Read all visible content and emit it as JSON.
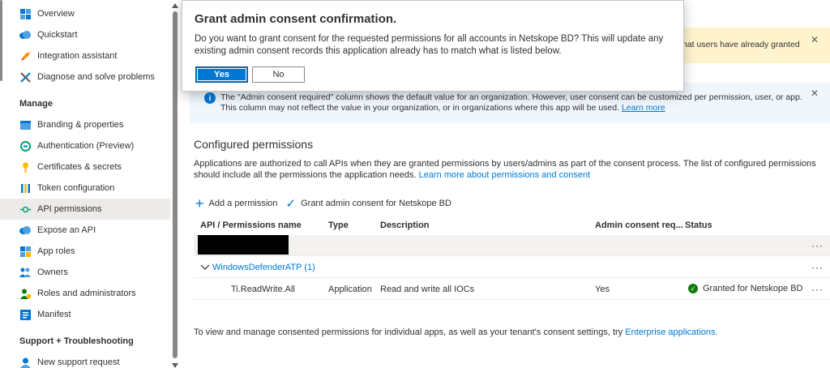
{
  "sidebar": {
    "items_top": [
      {
        "label": "Overview",
        "icon": "overview-icon",
        "color": "#0078d4"
      },
      {
        "label": "Quickstart",
        "icon": "cloud-icon",
        "color": "#0078d4"
      },
      {
        "label": "Integration assistant",
        "icon": "rocket-icon",
        "color": "#ff8c00"
      },
      {
        "label": "Diagnose and solve problems",
        "icon": "wrench-icon",
        "color": "#0078d4"
      }
    ],
    "manage_header": "Manage",
    "manage_items": [
      {
        "label": "Branding & properties",
        "icon": "branding-icon",
        "color": "#0078d4"
      },
      {
        "label": "Authentication (Preview)",
        "icon": "authentication-icon",
        "color": "#00a36c"
      },
      {
        "label": "Certificates & secrets",
        "icon": "key-icon",
        "color": "#ffb900"
      },
      {
        "label": "Token configuration",
        "icon": "token-icon",
        "color": "#0078d4"
      },
      {
        "label": "API permissions",
        "icon": "api-icon",
        "color": "#00a36c",
        "active": true
      },
      {
        "label": "Expose an API",
        "icon": "cloud-icon",
        "color": "#0078d4"
      },
      {
        "label": "App roles",
        "icon": "app-roles-icon",
        "color": "#0078d4"
      },
      {
        "label": "Owners",
        "icon": "owners-icon",
        "color": "#0078d4"
      },
      {
        "label": "Roles and administrators",
        "icon": "roles-icon",
        "color": "#107c10"
      },
      {
        "label": "Manifest",
        "icon": "manifest-icon",
        "color": "#0078d4"
      }
    ],
    "support_header": "Support + Troubleshooting",
    "support_items": [
      {
        "label": "New support request",
        "icon": "support-person-icon",
        "color": "#0078d4"
      }
    ]
  },
  "main": {
    "warning_banner_text": "hat users have already granted",
    "info_banner": {
      "text": "The \"Admin consent required\" column shows the default value for an organization. However, user consent can be customized per permission, user, or app. This column may not reflect the value in your organization, or in organizations where this app will be used.",
      "link": "Learn more"
    },
    "section_title": "Configured permissions",
    "description": "Applications are authorized to call APIs when they are granted permissions by users/admins as part of the consent process. The list of configured permissions should include all the permissions the application needs.",
    "description_link": "Learn more about permissions and consent",
    "toolbar": {
      "add_permission": "Add a permission",
      "grant_consent": "Grant admin consent for Netskope BD"
    },
    "table": {
      "headers": [
        "API / Permissions name",
        "Type",
        "Description",
        "Admin consent req...",
        "Status"
      ],
      "group_label": "WindowsDefenderATP (1)",
      "rows": [
        {
          "name": "Ti.ReadWrite.All",
          "type": "Application",
          "description": "Read and write all IOCs",
          "admin_consent": "Yes",
          "status": "Granted for Netskope BD"
        }
      ],
      "more": "···"
    },
    "footer_text": "To view and manage consented permissions for individual apps, as well as your tenant's consent settings, try",
    "footer_link": "Enterprise applications."
  },
  "dialog": {
    "title": "Grant admin consent confirmation.",
    "message": "Do you want to grant consent for the requested permissions for all accounts in Netskope BD? This will update any existing admin consent records this application already has to match what is listed below.",
    "yes_label": "Yes",
    "no_label": "No"
  },
  "colors": {
    "accent": "#0078d4",
    "warning_bg": "#fff4ce",
    "info_bg": "#eff6fc",
    "success": "#107c10"
  }
}
